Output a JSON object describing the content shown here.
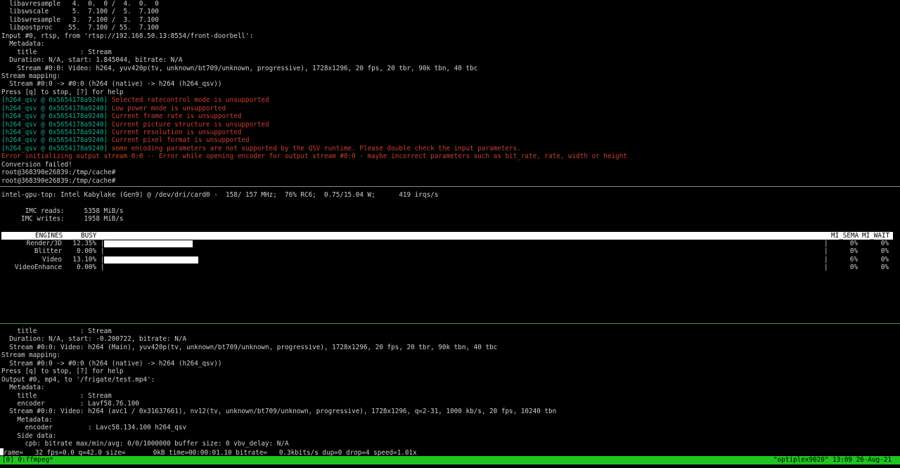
{
  "top_pane": {
    "lines": [
      {
        "text": "  libavresample   4.  0.  0 /  4.  0.  0"
      },
      {
        "text": "  libswscale      5.  7.100 /  5.  7.100"
      },
      {
        "text": "  libswresample   3.  7.100 /  3.  7.100"
      },
      {
        "text": "  libpostproc    55.  7.100 / 55.  7.100"
      },
      {
        "text": "Input #0, rtsp, from 'rtsp://192.168.50.13:8554/front-doorbell':"
      },
      {
        "text": "  Metadata:"
      },
      {
        "text": "    title           : Stream"
      },
      {
        "text": "  Duration: N/A, start: 1.845044, bitrate: N/A"
      },
      {
        "text": "    Stream #0:0: Video: h264, yuv420p(tv, unknown/bt709/unknown, progressive), 1728x1296, 20 fps, 20 tbr, 90k tbn, 40 tbc"
      },
      {
        "text": "Stream mapping:"
      },
      {
        "text": "  Stream #0:0 -> #0:0 (h264 (native) -> h264 (h264_qsv))"
      },
      {
        "text": "Press [q] to stop, [?] for help"
      },
      {
        "tag": "[h264_qsv @ 0x5654178a9240]",
        "text": " Selected ratecontrol mode is unsupported"
      },
      {
        "tag": "[h264_qsv @ 0x5654178a9240]",
        "text": " Low power mode is unsupported"
      },
      {
        "tag": "[h264_qsv @ 0x5654178a9240]",
        "text": " Current frame rate is unsupported"
      },
      {
        "tag": "[h264_qsv @ 0x5654178a9240]",
        "text": " Current picture structure is unsupported"
      },
      {
        "tag": "[h264_qsv @ 0x5654178a9240]",
        "text": " Current resolution is unsupported"
      },
      {
        "tag": "[h264_qsv @ 0x5654178a9240]",
        "text": " Current pixel format is unsupported"
      },
      {
        "tag": "[h264_qsv @ 0x5654178a9240]",
        "text": " some encoding parameters are not supported by the QSV runtime. Please double check the input parameters."
      },
      {
        "text": "Error initializing output stream 0:0 -- Error while opening encoder for output stream #0:0 - maybe incorrect parameters such as bit_rate, rate, width or height",
        "error": true
      },
      {
        "text": "Conversion failed!"
      },
      {
        "text": "root@368390e26839:/tmp/cache#"
      },
      {
        "text": "root@368390e26839:/tmp/cache#"
      }
    ]
  },
  "gpu_top": {
    "title_line": "intel-gpu-top: Intel Kabylake (Gen9) @ /dev/dri/card0 -  158/ 157 MHz;  76% RC6;  0.75/15.04 W;      419 irqs/s",
    "imc_reads_line": "      IMC reads:     5358 MiB/s",
    "imc_writes_line": "     IMC writes:     1958 MiB/s",
    "header": {
      "engines": "ENGINES",
      "busy": "BUSY",
      "mi_sema": "MI_SEMA",
      "mi_wait": "MI_WAIT"
    },
    "engines": [
      {
        "name": "Render/3D",
        "busy": "12.35%",
        "fraction": 0.1235,
        "sema": "0%",
        "wait": "0%"
      },
      {
        "name": "Blitter",
        "busy": "0.00%",
        "fraction": 0.0,
        "sema": "0%",
        "wait": "0%"
      },
      {
        "name": "Video",
        "busy": "13.10%",
        "fraction": 0.131,
        "sema": "6%",
        "wait": "0%"
      },
      {
        "name": "VideoEnhance",
        "busy": "0.00%",
        "fraction": 0.0,
        "sema": "0%",
        "wait": "0%"
      }
    ]
  },
  "bottom_pane": {
    "lines": [
      "    title           : Stream",
      "  Duration: N/A, start: -0.200722, bitrate: N/A",
      "  Stream #0:0: Video: h264 (Main), yuv420p(tv, unknown/bt709/unknown, progressive), 1728x1296, 20 fps, 20 tbr, 90k tbn, 40 tbc",
      "Stream mapping:",
      "  Stream #0:0 -> #0:0 (h264 (native) -> h264 (h264_qsv))",
      "Press [q] to stop, [?] for help",
      "Output #0, mp4, to '/frigate/test.mp4':",
      "  Metadata:",
      "    title           : Stream",
      "    encoder         : Lavf58.76.100",
      "  Stream #0:0: Video: h264 (avc1 / 0x31637661), nv12(tv, unknown/bt709/unknown, progressive), 1728x1296, q=2-31, 1000 kb/s, 20 fps, 10240 tbn",
      "    Metadata:",
      "      encoder         : Lavc58.134.100 h264_qsv",
      "    Side data:",
      "      cpb: bitrate max/min/avg: 0/0/1000000 buffer size: 0 vbv_delay: N/A"
    ],
    "progress_prefix": "rame=",
    "progress_text": "   32 fps=0.0 q=42.0 size=       0kB time=00:00:01.10 bitrate=   0.3kbits/s dup=0 drop=4 speed=1.01x"
  },
  "status_bar": {
    "session": "[0] 0:ffmpeg*",
    "right": "\"optiplex9020\" 13:09 26-Aug-21"
  },
  "colors": {
    "background": "#000000",
    "text": "#cfcfcf",
    "tag": "#19a88c",
    "error": "#c8402a",
    "status_bar": "#1fc41f"
  }
}
